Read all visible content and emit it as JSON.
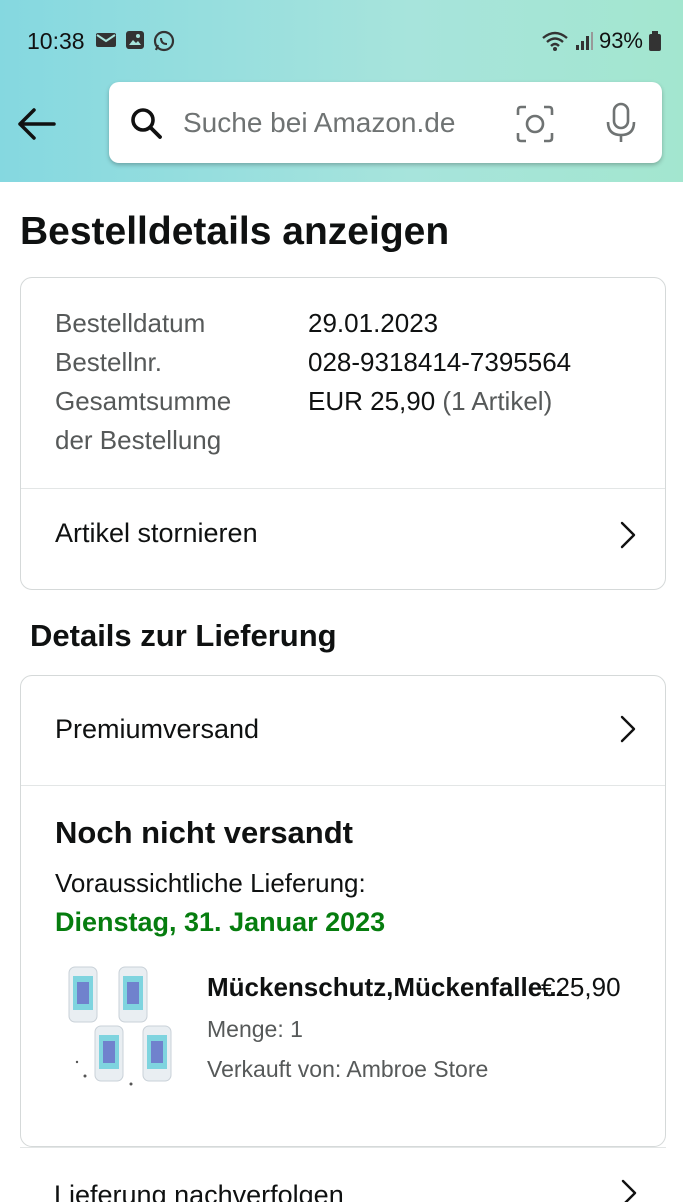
{
  "status_bar": {
    "time": "10:38",
    "battery": "93%"
  },
  "search": {
    "placeholder": "Suche bei Amazon.de"
  },
  "page_title": "Bestelldetails anzeigen",
  "order_info": {
    "date_label": "Bestelldatum",
    "date_value": "29.01.2023",
    "number_label": "Bestellnr.",
    "number_value": "028-9318414-7395564",
    "total_label_line1": "Gesamtsumme",
    "total_label_line2": "der Bestellung",
    "total_value": "EUR 25,90",
    "total_items": "(1 Artikel)",
    "cancel_label": "Artikel stornieren"
  },
  "delivery": {
    "section_title": "Details zur Lieferung",
    "shipping_method": "Premiumversand",
    "shipment_status": "Noch nicht versandt",
    "eta_label": "Voraussichtliche Lieferung:",
    "eta_date": "Dienstag, 31. Januar 2023",
    "product": {
      "name": "Mückenschutz,Mückenfalle...",
      "price": "€25,90",
      "quantity": "Menge: 1",
      "seller": "Verkauft von: Ambroe Store"
    },
    "track_label": "Lieferung nachverfolgen"
  },
  "colors": {
    "eta_green": "#067d0f",
    "header_start": "#85d8e0",
    "header_end": "#a3e6cf"
  },
  "icons": [
    "back-arrow-icon",
    "search-icon",
    "camera-icon",
    "mic-icon",
    "chevron-right-icon"
  ]
}
